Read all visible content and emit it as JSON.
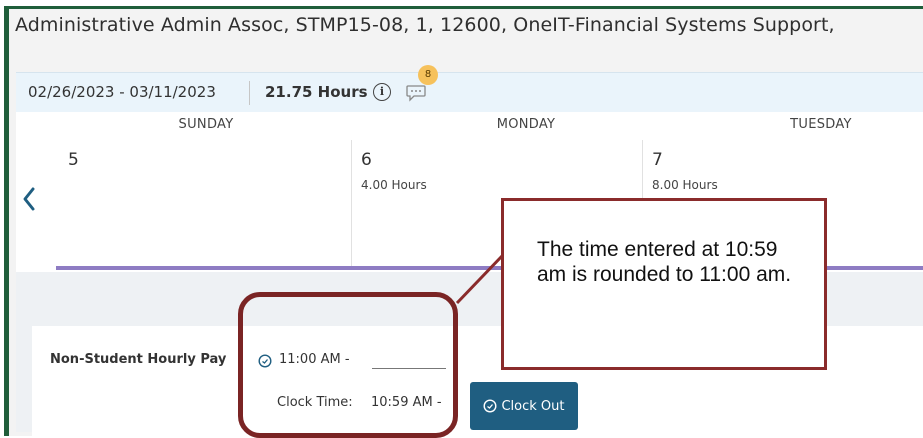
{
  "job": {
    "title": "Administrative Admin Assoc, STMP15-08, 1, 12600, OneIT-Financial Systems Support,"
  },
  "period": {
    "range": "02/26/2023 - 03/11/2023",
    "total_hours": "21.75 Hours",
    "info_icon": "info-icon",
    "comment_icon": "comment-icon",
    "comment_count": "8"
  },
  "calendar": {
    "prev_icon": "chevron-left-icon",
    "days": [
      {
        "name": "SUNDAY",
        "date": "5",
        "hours": ""
      },
      {
        "name": "MONDAY",
        "date": "6",
        "hours": "4.00 Hours"
      },
      {
        "name": "TUESDAY",
        "date": "7",
        "hours": "8.00 Hours"
      }
    ]
  },
  "entry": {
    "pay_type": "Non-Student Hourly Pay",
    "start_icon": "clock-icon",
    "start_time": "11:00 AM -",
    "end_time_value": "",
    "clock_time_label": "Clock Time:",
    "clock_time_value": "10:59 AM -",
    "clock_out_label": "Clock Out"
  },
  "callout": {
    "text": "The time entered at 10:59 am is rounded to 11:00 am."
  },
  "colors": {
    "accent": "#1f5e81",
    "week_underline": "#8e7cc3",
    "callout_border": "#8a2b2b",
    "badge": "#f6c15b"
  }
}
